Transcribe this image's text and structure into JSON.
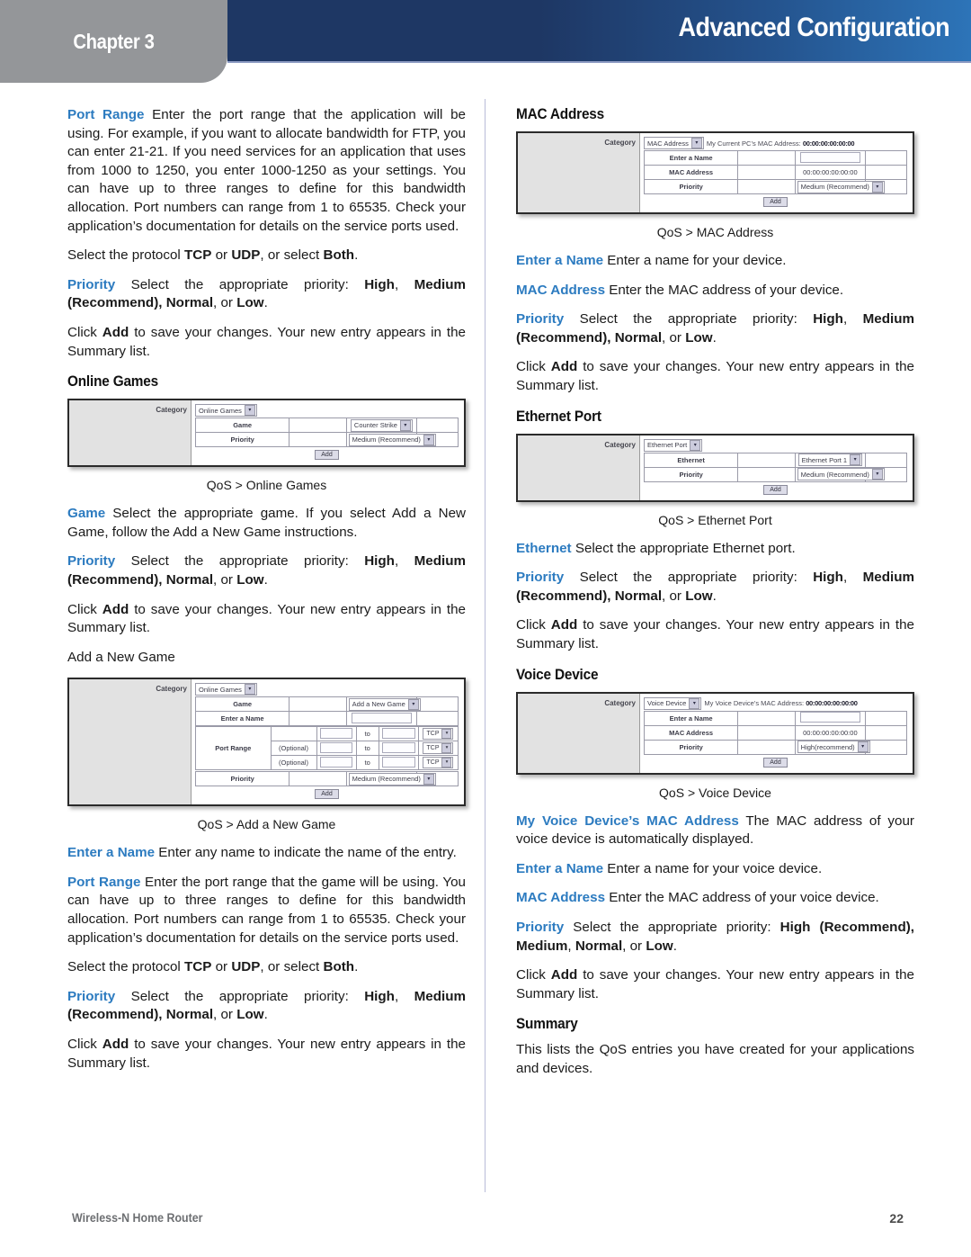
{
  "header": {
    "chapter": "Chapter 3",
    "title": "Advanced Configuration"
  },
  "footer": {
    "product": "Wireless-N Home Router",
    "page": "22"
  },
  "left_column": {
    "p_port_range_lead": "Port Range",
    "p_port_range_body": "  Enter the port range that the application will be using. For example, if you want to allocate bandwidth for FTP, you can enter 21-21. If you need services for an application that uses from 1000 to 1250, you enter 1000-1250 as your settings. You can have up to three ranges to define for this bandwidth allocation. Port numbers can range from 1 to 65535. Check your application’s documentation for details on the service ports used.",
    "p_protocol_pre": "Select the protocol ",
    "p_protocol_tcp": "TCP",
    "p_protocol_or1": " or ",
    "p_protocol_udp": "UDP",
    "p_protocol_or2": ", or select ",
    "p_protocol_both": "Both",
    "p_protocol_end": ".",
    "p_priority_lead": "Priority",
    "p_priority_mid": "  Select the appropriate priority: ",
    "p_priority_high": "High",
    "p_priority_comma1": ", ",
    "p_priority_medium": "Medium",
    "p_priority_open": " (",
    "p_priority_recommend": "Recommend",
    "p_priority_close": "), ",
    "p_priority_normal": "Normal",
    "p_priority_or": ", or ",
    "p_priority_low": "Low",
    "p_priority_end": ".",
    "p_add_pre": "Click ",
    "p_add_bold": "Add",
    "p_add_post": " to save your changes. Your new entry appears in the Summary list.",
    "h_online_games": "Online Games",
    "cap_online_games": "QoS > Online Games",
    "p_game_lead": "Game",
    "p_game_body": "  Select the appropriate game. If you select Add a New Game, follow the Add a New Game instructions.",
    "p_add_a_new_game": "Add a New Game",
    "cap_add_a_new_game": "QoS > Add a New Game",
    "p_entername_lead": "Enter a Name",
    "p_entername_body": "  Enter any name to indicate the name of the entry.",
    "p_portrange2_lead": "Port Range",
    "p_portrange2_body": "  Enter the port range that the game will be using. You can have up to three ranges to define for this bandwidth allocation. Port numbers can range from 1 to 65535. Check your application’s documentation for details on the service ports used."
  },
  "right_column": {
    "h_mac_address": "MAC Address",
    "cap_mac_address": "QoS > MAC Address",
    "p_entername_lead": "Enter a Name",
    "p_entername_body": "  Enter a name for your device.",
    "p_macaddr_lead": "MAC Address",
    "p_macaddr_body": "  Enter the MAC address of your device.",
    "h_ethernet_port": "Ethernet Port",
    "cap_ethernet_port": "QoS > Ethernet Port",
    "p_ethernet_lead": "Ethernet",
    "p_ethernet_body": "  Select the appropriate Ethernet port.",
    "h_voice_device": "Voice Device",
    "cap_voice_device": "QoS > Voice Device",
    "p_myvoice_lead": "My Voice Device’s MAC Address",
    "p_myvoice_body": " The MAC address of your voice device is automatically displayed.",
    "p_vd_entername_lead": "Enter a Name",
    "p_vd_entername_body": "  Enter a name for your voice device.",
    "p_vd_macaddr_lead": "MAC Address",
    "p_vd_macaddr_body": " Enter the MAC address of your voice device.",
    "p_vd_priority_lead": "Priority",
    "p_vd_priority_mid": " Select the appropriate priority: ",
    "p_vd_priority_high": "High",
    "p_vd_priority_open": " (",
    "p_vd_priority_recommend": "Recommend",
    "p_vd_priority_close": "), ",
    "p_vd_priority_medium": "Medium",
    "p_vd_priority_comma": ", ",
    "p_vd_priority_normal": "Normal",
    "p_vd_priority_or": ", or ",
    "p_vd_priority_low": "Low",
    "p_vd_priority_end": ".",
    "h_summary": "Summary",
    "p_summary_body": "This lists the QoS entries you have created for your applications and devices."
  },
  "screenshots": {
    "online_games": {
      "category_label": "Category",
      "category_value": "Online Games",
      "rows": [
        {
          "label": "Game",
          "value": "Counter Strike"
        },
        {
          "label": "Priority",
          "value": "Medium (Recommend)"
        }
      ],
      "add_label": "Add"
    },
    "add_new_game": {
      "category_label": "Category",
      "category_value": "Online Games",
      "game_label": "Game",
      "game_value": "Add a New Game",
      "entername_label": "Enter a Name",
      "entername_value": "",
      "portrange_label": "Port Range",
      "port_rows": [
        {
          "optional": "",
          "start": "",
          "to": "to",
          "end": "",
          "proto": "TCP"
        },
        {
          "optional": "(Optional)",
          "start": "",
          "to": "to",
          "end": "",
          "proto": "TCP"
        },
        {
          "optional": "(Optional)",
          "start": "",
          "to": "to",
          "end": "",
          "proto": "TCP"
        }
      ],
      "priority_label": "Priority",
      "priority_value": "Medium (Recommend)",
      "add_label": "Add"
    },
    "mac_address": {
      "category_label": "Category",
      "category_value": "MAC Address",
      "note_text": "My Current PC’s MAC Address: ",
      "note_value": "00:00:00:00:00:00",
      "rows": [
        {
          "label": "Enter a Name",
          "value": "",
          "input": true
        },
        {
          "label": "MAC Address",
          "value": "00:00:00:00:00:00",
          "input": false
        },
        {
          "label": "Priority",
          "value": "Medium (Recommend)",
          "select": true
        }
      ],
      "add_label": "Add"
    },
    "ethernet_port": {
      "category_label": "Category",
      "category_value": "Ethernet Port",
      "rows": [
        {
          "label": "Ethernet",
          "value": "Ethernet Port 1"
        },
        {
          "label": "Priority",
          "value": "Medium (Recommend)"
        }
      ],
      "add_label": "Add"
    },
    "voice_device": {
      "category_label": "Category",
      "category_value": "Voice Device",
      "note_text": "My Voice Device’s MAC Address: ",
      "note_value": "00:00:00:00:00:00",
      "rows": [
        {
          "label": "Enter a Name",
          "value": "",
          "input": true
        },
        {
          "label": "MAC Address",
          "value": "00:00:00:00:00:00",
          "input": false
        },
        {
          "label": "Priority",
          "value": "High(recommend)",
          "select": true
        }
      ],
      "add_label": "Add"
    }
  },
  "colors": {
    "lead_blue": "#2c7bc0",
    "header_navy": "#1e3764",
    "header_blue": "#2d74b8",
    "tab_gray": "#949699"
  }
}
